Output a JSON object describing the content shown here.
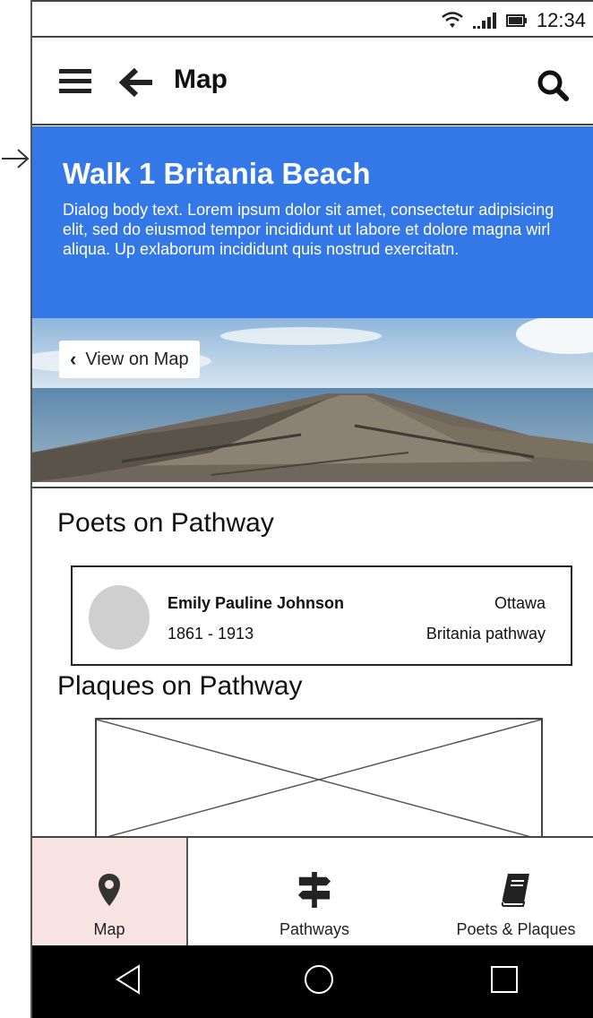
{
  "status_bar": {
    "time": "12:34"
  },
  "app_bar": {
    "title": "Map"
  },
  "header": {
    "title": "Walk 1 Britania Beach",
    "body": "Dialog body text.  Lorem ipsum dolor sit amet, consectetur adipisicing elit, sed do eiusmod tempor incididunt ut labore et dolore magna wirl aliqua. Up exlaborum incididunt quis nostrud exercitatn.",
    "color": "#3478e8"
  },
  "photo": {
    "view_on_map_label": "View on Map"
  },
  "poets_section": {
    "heading": "Poets on Pathway",
    "poet": {
      "name": "Emily Pauline Johnson",
      "years": "1861 - 1913",
      "city": "Ottawa",
      "pathway": "Britania pathway"
    }
  },
  "plaques_section": {
    "heading": "Plaques on Pathway"
  },
  "bottom_nav": {
    "items": [
      {
        "label": "Map",
        "icon": "map-pin-icon",
        "active": true
      },
      {
        "label": "Pathways",
        "icon": "signpost-icon",
        "active": false
      },
      {
        "label": "Poets & Plaques",
        "icon": "book-icon",
        "active": false
      }
    ],
    "active_color": "#f8e3e3"
  }
}
